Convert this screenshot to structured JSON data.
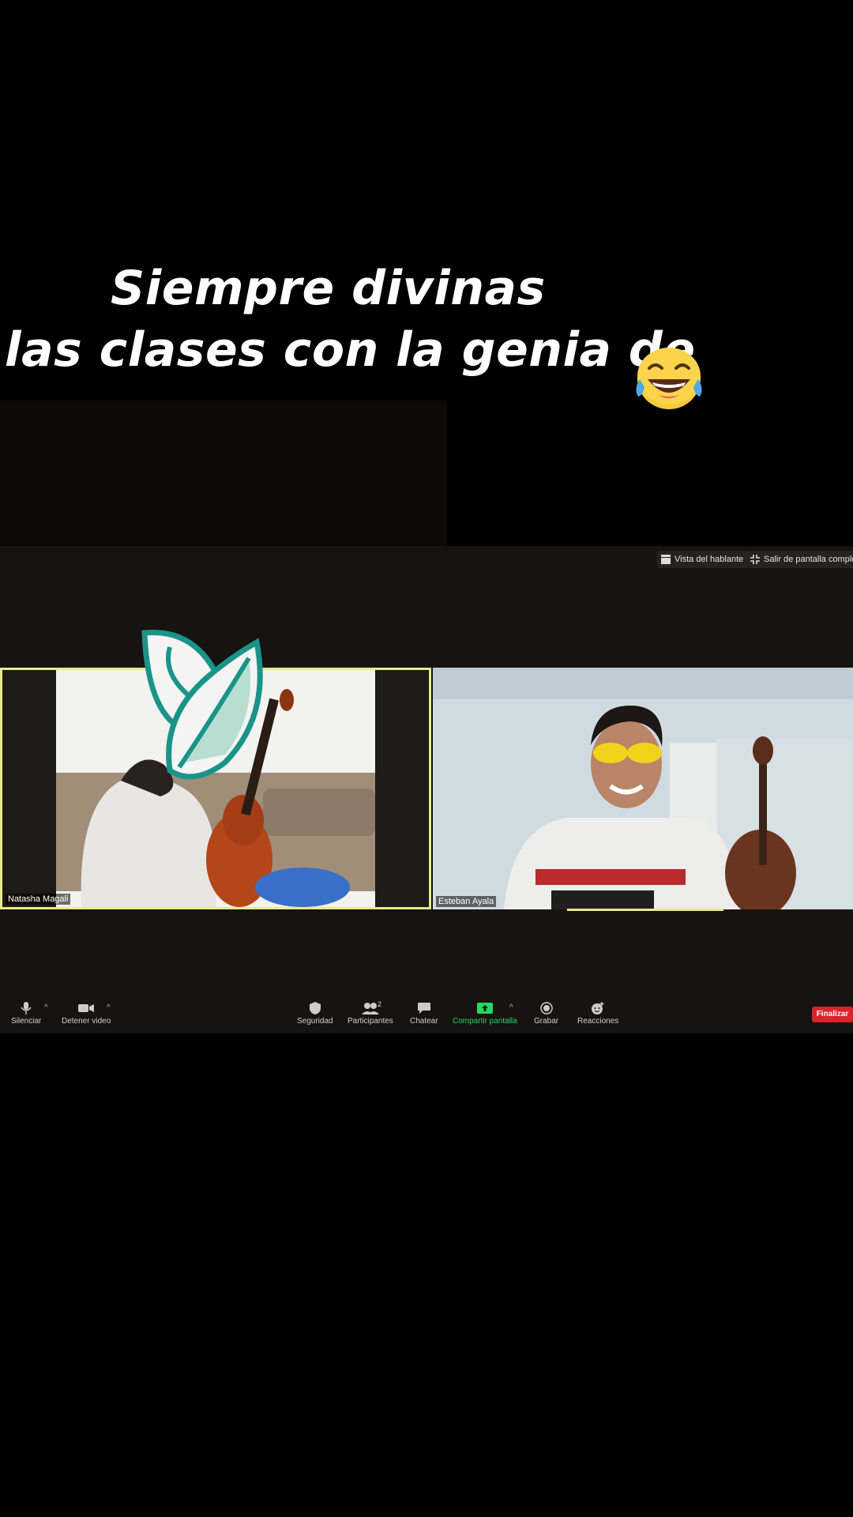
{
  "caption": {
    "line1": "Siempre divinas",
    "line2": "las clases con la genia de",
    "emoji": "face-with-tears-of-joy"
  },
  "top_bar": {
    "speaker_view": "Vista del hablante",
    "exit_fullscreen": "Salir de pantalla completa"
  },
  "participants": [
    {
      "name": "Natasha Magali",
      "highlighted": true
    },
    {
      "name": "Esteban Ayala",
      "highlighted": false
    }
  ],
  "toolbar": {
    "mute": "Silenciar",
    "stop_video": "Detener video",
    "security": "Seguridad",
    "participants": "Participantes",
    "participants_count": "2",
    "chat": "Chatear",
    "share_screen": "Compartir pantalla",
    "record": "Grabar",
    "reactions": "Reacciones",
    "end": "Finalizar"
  },
  "colors": {
    "active_speaker_border": "#e9e88e",
    "share_green": "#23d962",
    "end_red": "#d8232a",
    "logo_teal": "#1a9488"
  }
}
